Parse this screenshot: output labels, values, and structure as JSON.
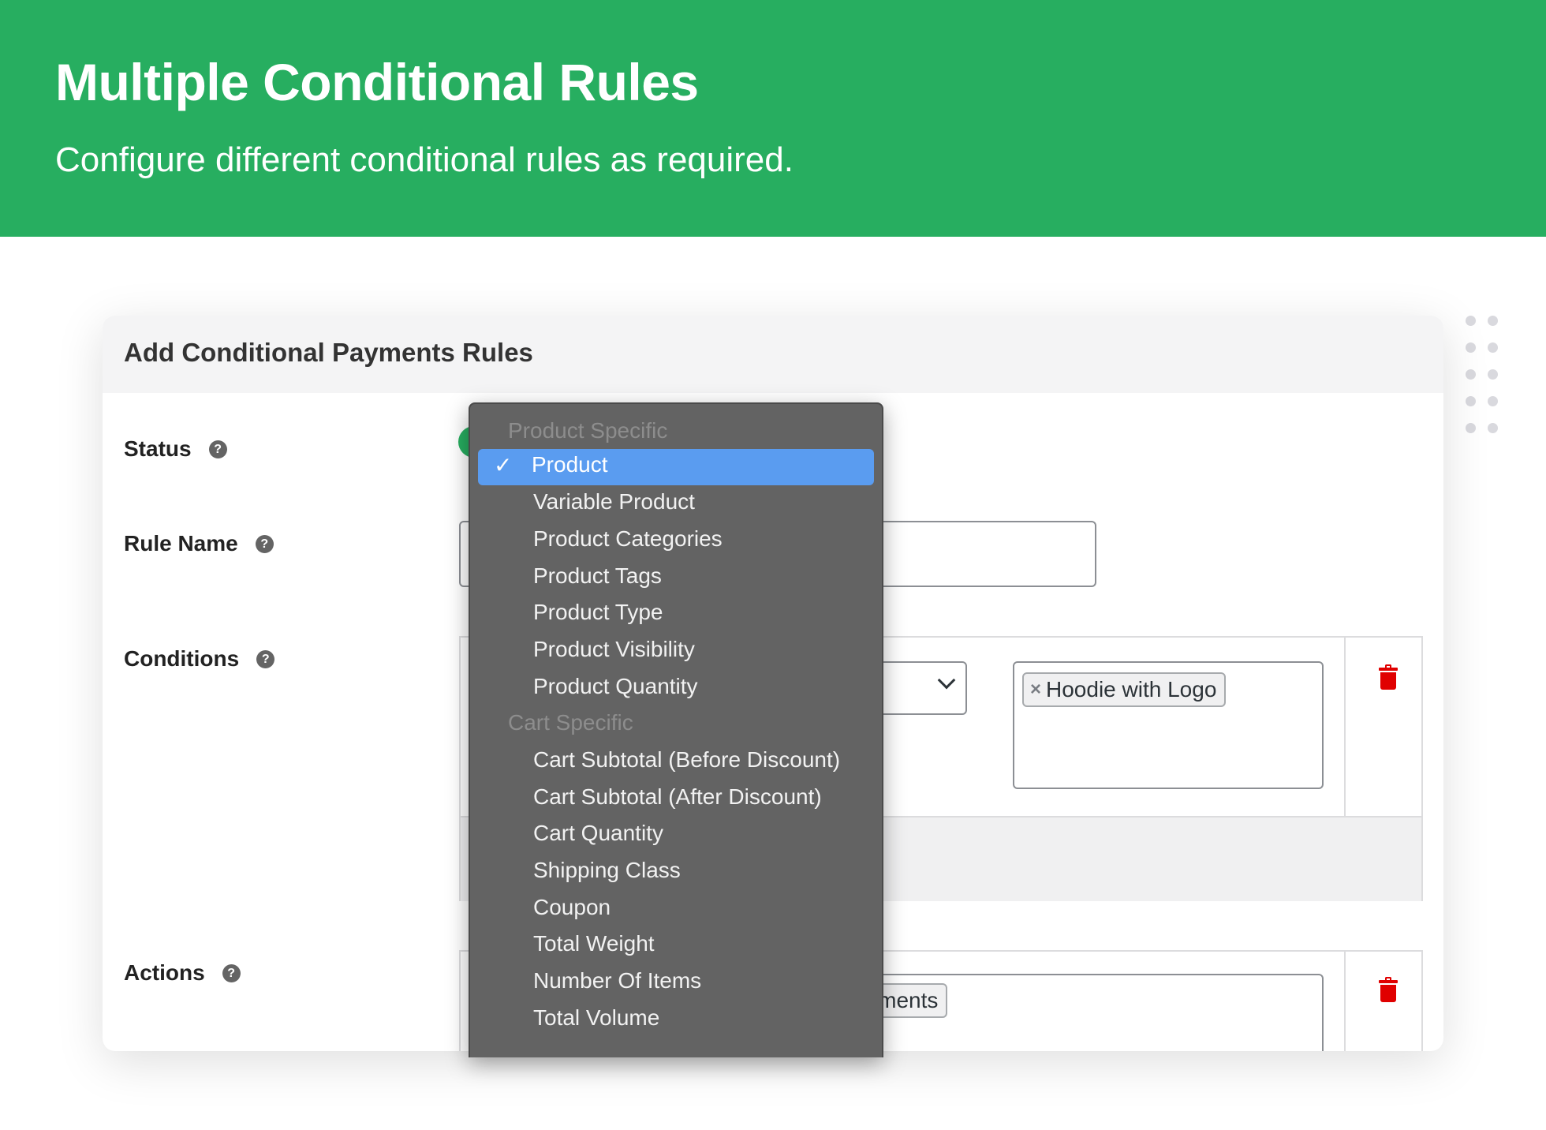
{
  "banner": {
    "title": "Multiple Conditional Rules",
    "subtitle": "Configure different conditional rules as required.",
    "color": "#27ae60"
  },
  "card": {
    "title": "Add Conditional Payments Rules",
    "fields": {
      "status": "Status",
      "rule_name": "Rule Name",
      "conditions": "Conditions",
      "actions": "Actions"
    },
    "help_glyph": "?"
  },
  "conditions": {
    "operator_value": "= )",
    "selected_product": "Hoodie with Logo",
    "chip_remove": "×"
  },
  "actions": {
    "chip_text": "payments"
  },
  "dropdown": {
    "check": "✓",
    "groups": {
      "product_specific": "Product Specific",
      "cart_specific": "Cart Specific"
    },
    "items": [
      "Product",
      "Variable Product",
      "Product Categories",
      "Product Tags",
      "Product Type",
      "Product Visibility",
      "Product Quantity",
      "Cart Subtotal (Before Discount)",
      "Cart Subtotal (After Discount)",
      "Cart Quantity",
      "Shipping Class",
      "Coupon",
      "Total Weight",
      "Number Of Items",
      "Total Volume"
    ],
    "selected": "Product",
    "selected_color": "#5a9cf0"
  },
  "icons": {
    "delete": "trash-icon",
    "help": "help-icon",
    "chevron": "chevron-down-icon"
  }
}
